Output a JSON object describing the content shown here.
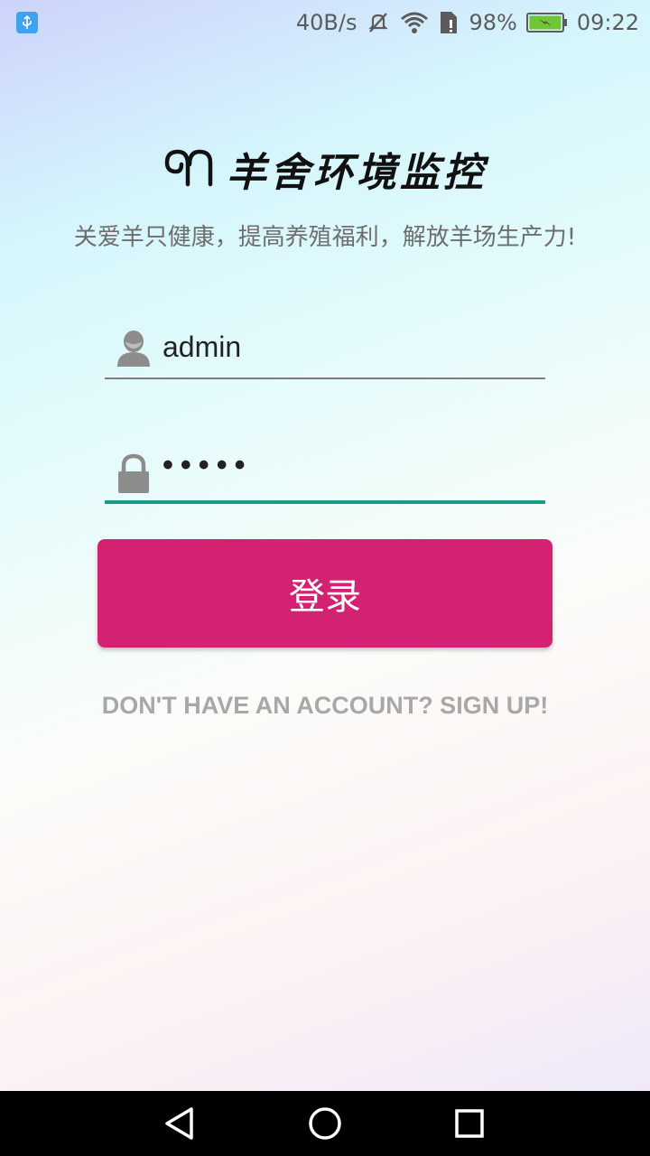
{
  "status_bar": {
    "network_speed": "40B/s",
    "battery_percent": "98%",
    "time": "09:22",
    "icons": [
      "usb-icon",
      "mute-icon",
      "wifi-icon",
      "sim-icon",
      "battery-charging-icon"
    ]
  },
  "app": {
    "title": "羊舍环境监控",
    "slogan": "关爱羊只健康，提高养殖福利，解放羊场生产力!"
  },
  "form": {
    "username": {
      "value": "admin",
      "icon": "user-icon"
    },
    "password": {
      "value": "•••••",
      "icon": "lock-icon"
    },
    "login_button": "登录",
    "signup_link": "DON'T HAVE AN ACCOUNT? SIGN UP!"
  },
  "colors": {
    "accent": "#d42273",
    "focus_underline": "#1a9a8c",
    "link_text": "#a8a8a8"
  },
  "nav_bar": {
    "icons": [
      "back-icon",
      "home-icon",
      "recent-apps-icon"
    ]
  }
}
